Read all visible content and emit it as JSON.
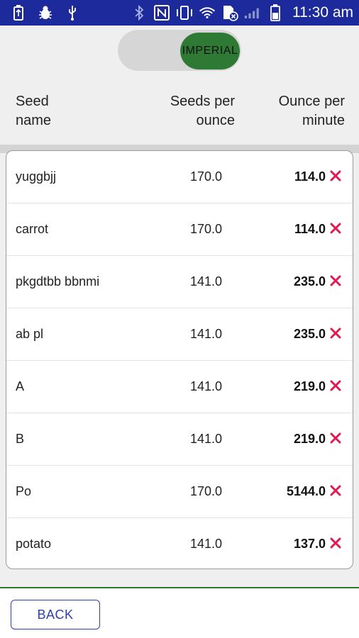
{
  "status_bar": {
    "time": "11:30 am",
    "icons_left": [
      "usb-storage-icon",
      "bug-icon",
      "usb-icon"
    ],
    "icons_right": [
      "bluetooth-icon",
      "nfc-icon",
      "vibrate-icon",
      "wifi-icon",
      "sim-no-signal-icon",
      "cell-signal-icon",
      "battery-icon"
    ]
  },
  "toggle": {
    "label": "IMPERIAL",
    "state": "on"
  },
  "columns": {
    "name": "Seed name",
    "name_line1": "Seed",
    "name_line2": "name",
    "seeds_line1": "Seeds per",
    "seeds_line2": "ounce",
    "oz_line1": "Ounce per",
    "oz_line2": "minute"
  },
  "rows": [
    {
      "name": "yuggbjj",
      "seeds": "170.0",
      "oz": "114.0"
    },
    {
      "name": "carrot",
      "seeds": "170.0",
      "oz": "114.0"
    },
    {
      "name": "pkgdtbb bbnmi",
      "seeds": "141.0",
      "oz": "235.0"
    },
    {
      "name": "ab pl",
      "seeds": "141.0",
      "oz": "235.0"
    },
    {
      "name": "A",
      "seeds": "141.0",
      "oz": "219.0"
    },
    {
      "name": "B",
      "seeds": "141.0",
      "oz": "219.0"
    },
    {
      "name": "Po",
      "seeds": "170.0",
      "oz": "5144.0"
    },
    {
      "name": "potato",
      "seeds": "141.0",
      "oz": "137.0"
    }
  ],
  "back_button": {
    "label": "BACK"
  },
  "colors": {
    "status_bar": "#1d2a9c",
    "toggle_on": "#2e7a35",
    "delete_icon": "#e0194f",
    "back_button": "#2d3fb3"
  }
}
